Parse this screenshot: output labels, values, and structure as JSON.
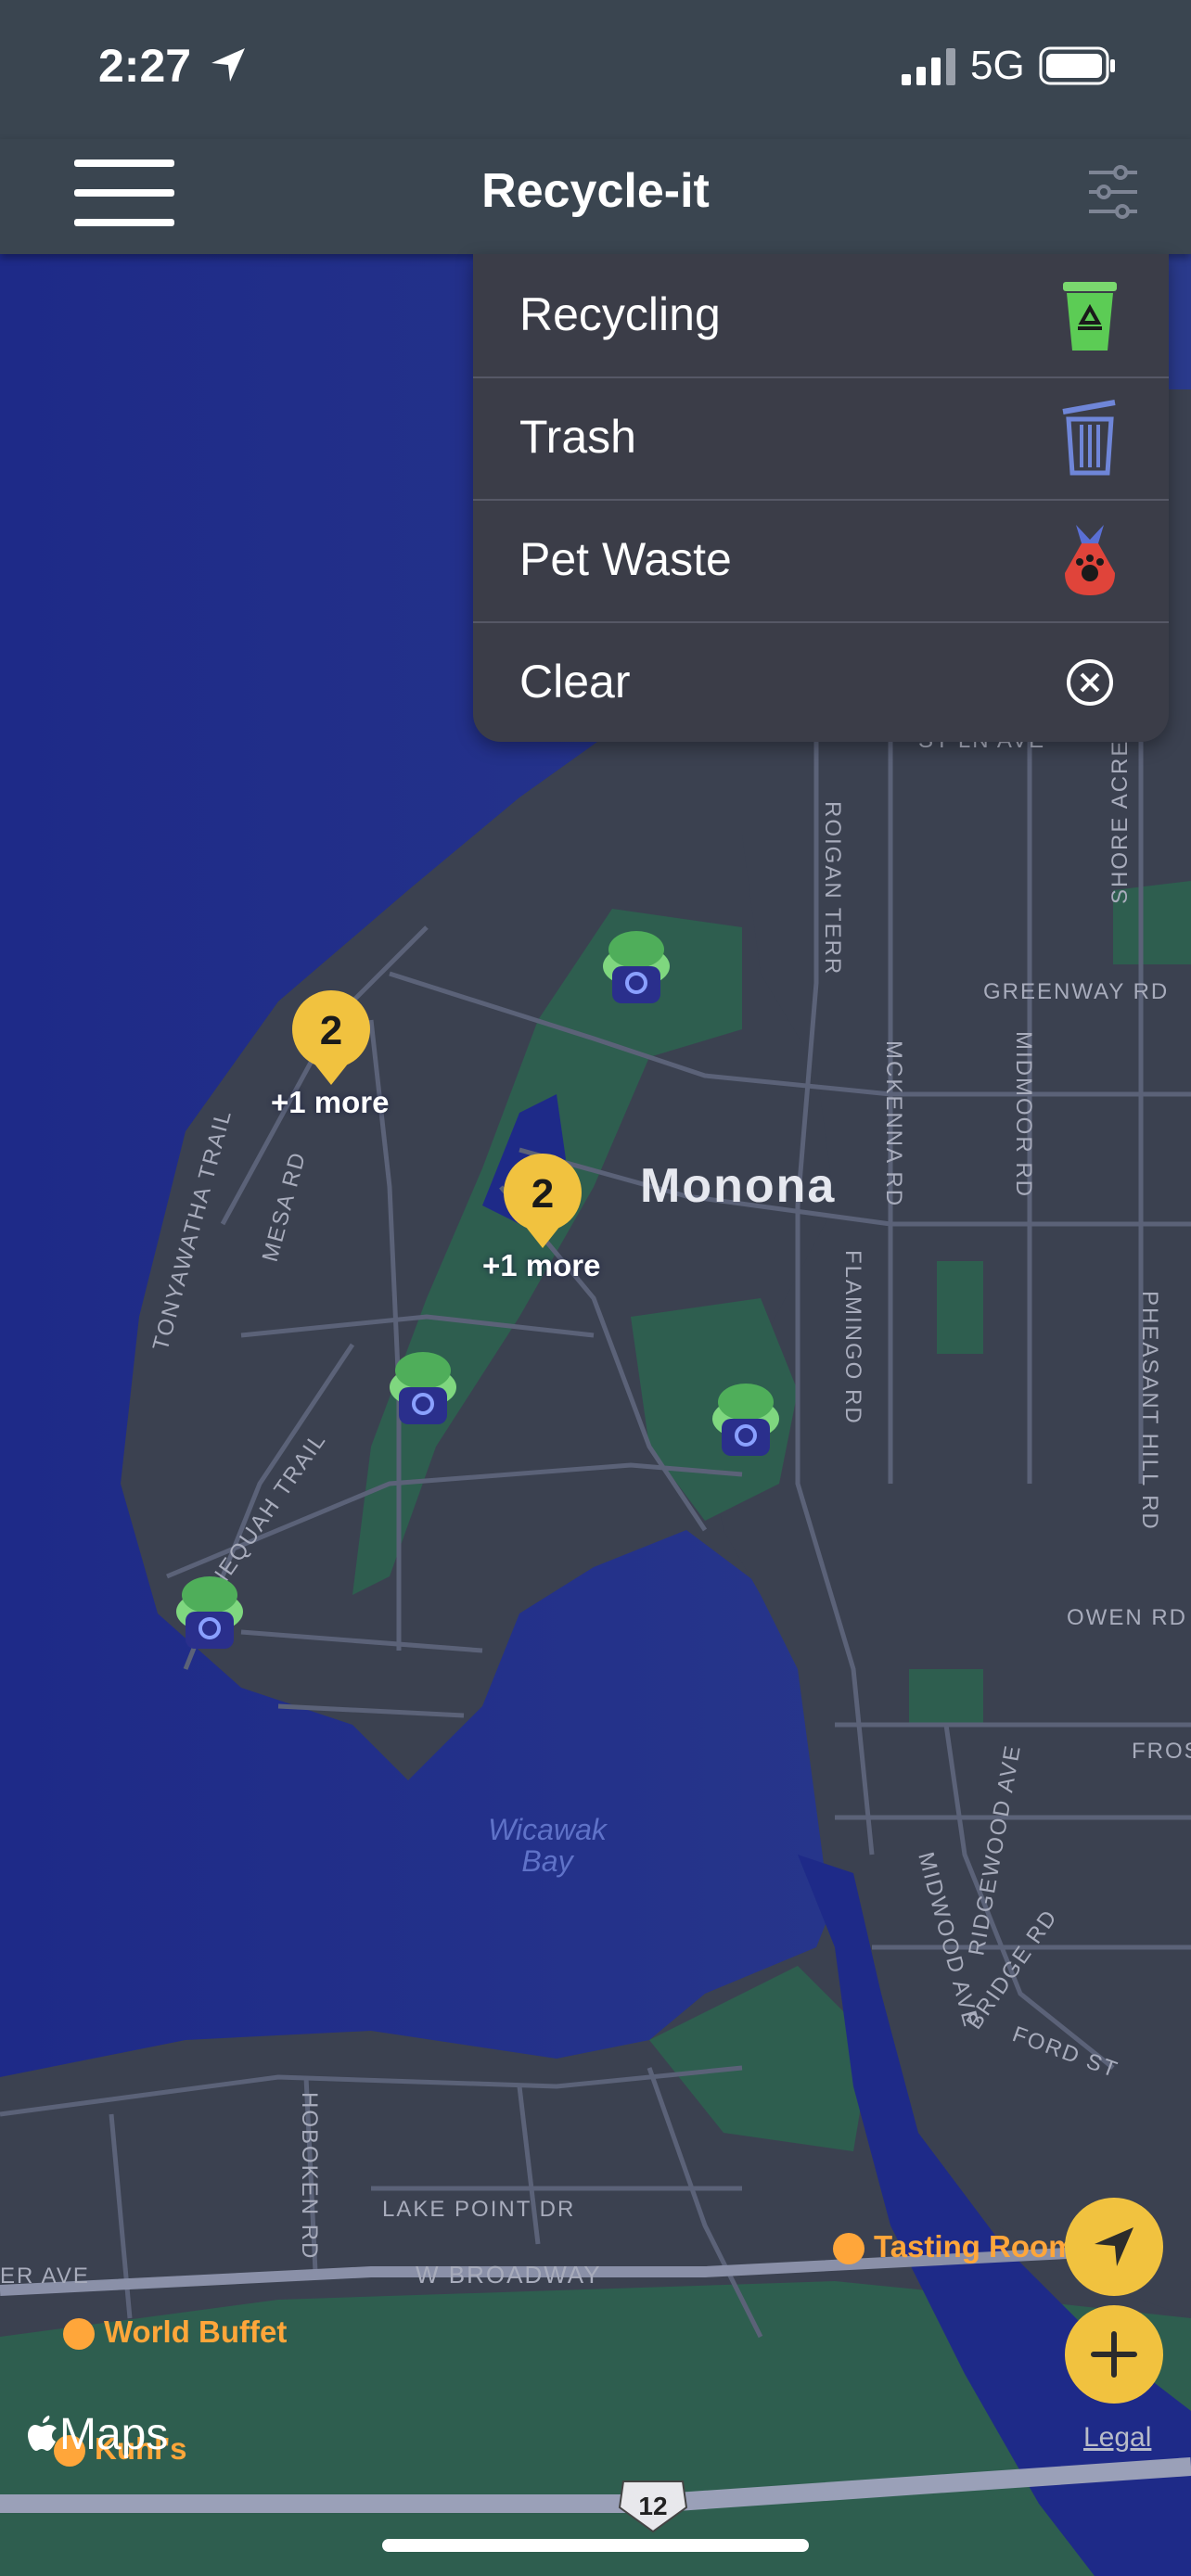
{
  "status_bar": {
    "time": "2:27",
    "network": "5G"
  },
  "nav": {
    "title": "Recycle-it"
  },
  "filter_menu": {
    "items": [
      {
        "label": "Recycling",
        "icon": "recycling-bin-icon"
      },
      {
        "label": "Trash",
        "icon": "trash-can-icon"
      },
      {
        "label": "Pet Waste",
        "icon": "pet-waste-bag-icon"
      },
      {
        "label": "Clear",
        "icon": "clear-circle-x-icon"
      }
    ]
  },
  "map": {
    "place_name": "Monona",
    "water_label_line1": "Wicawak",
    "water_label_line2": "Bay",
    "clusters": [
      {
        "count": "2",
        "more": "+1 more"
      },
      {
        "count": "2",
        "more": "+1 more"
      }
    ],
    "street_labels": [
      "ROIGAN TERR",
      "SHORE ACRES",
      "GREENWAY RD",
      "MCKENNA RD",
      "MIDMOOR RD",
      "TONYAWATHA TRAIL",
      "MESA RD",
      "FLAMINGO RD",
      "PHEASANT HILL RD",
      "NNEQUAH TRAIL",
      "OWEN RD",
      "FROS",
      "RIDGEWOOD AVE",
      "MIDWOOD AVE",
      "BRIDGE RD",
      "FORD ST",
      "HOBOKEN RD",
      "LAKE POINT DR",
      "W BROADWAY",
      "ER AVE",
      "ST LN AVE"
    ],
    "pois": [
      "Tasting Room",
      "World Buffet",
      "Kuhl's"
    ],
    "highway_shield": "12",
    "maps_attribution": "Maps",
    "legal": "Legal"
  },
  "colors": {
    "accent": "#f1c23f",
    "water": "#1f2b8a",
    "land": "#3b4150",
    "park": "#2e5e4f",
    "bar": "#3a4550"
  }
}
